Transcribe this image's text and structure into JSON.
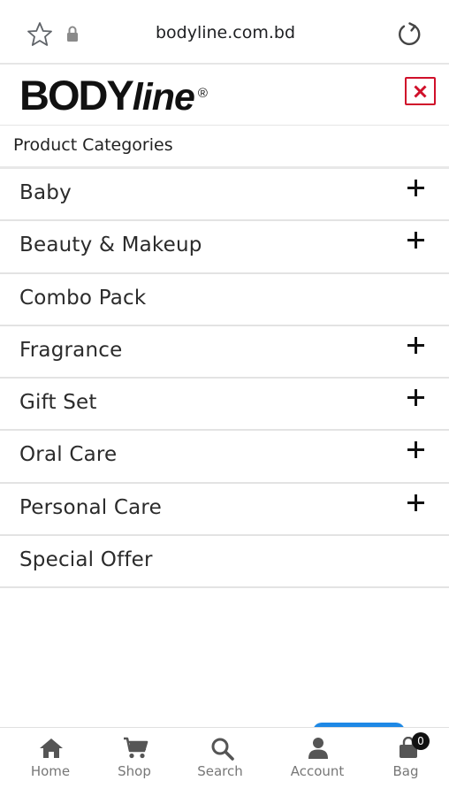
{
  "browser": {
    "url": "bodyline.com.bd",
    "icons": [
      "star-icon",
      "lock-icon",
      "reload-icon"
    ]
  },
  "panel": {
    "logo_main": "BODY",
    "logo_italic": "line",
    "logo_registered": "®",
    "close_icon": "close-icon",
    "accent_color": "#d0102a",
    "section_title": "Product Categories"
  },
  "categories": [
    {
      "label": "Baby",
      "expandable": true
    },
    {
      "label": "Beauty & Makeup",
      "expandable": true
    },
    {
      "label": "Combo Pack",
      "expandable": false
    },
    {
      "label": "Fragrance",
      "expandable": true
    },
    {
      "label": "Gift Set",
      "expandable": true
    },
    {
      "label": "Oral Care",
      "expandable": true
    },
    {
      "label": "Personal Care",
      "expandable": true
    },
    {
      "label": "Special Offer",
      "expandable": false
    }
  ],
  "bottom_nav": {
    "items": [
      {
        "label": "Home",
        "icon": "home-icon"
      },
      {
        "label": "Shop",
        "icon": "cart-icon"
      },
      {
        "label": "Search",
        "icon": "search-icon"
      },
      {
        "label": "Account",
        "icon": "user-icon"
      },
      {
        "label": "Bag",
        "icon": "bag-icon"
      }
    ],
    "bag_count": "0",
    "accent_color": "#1e88e5"
  }
}
